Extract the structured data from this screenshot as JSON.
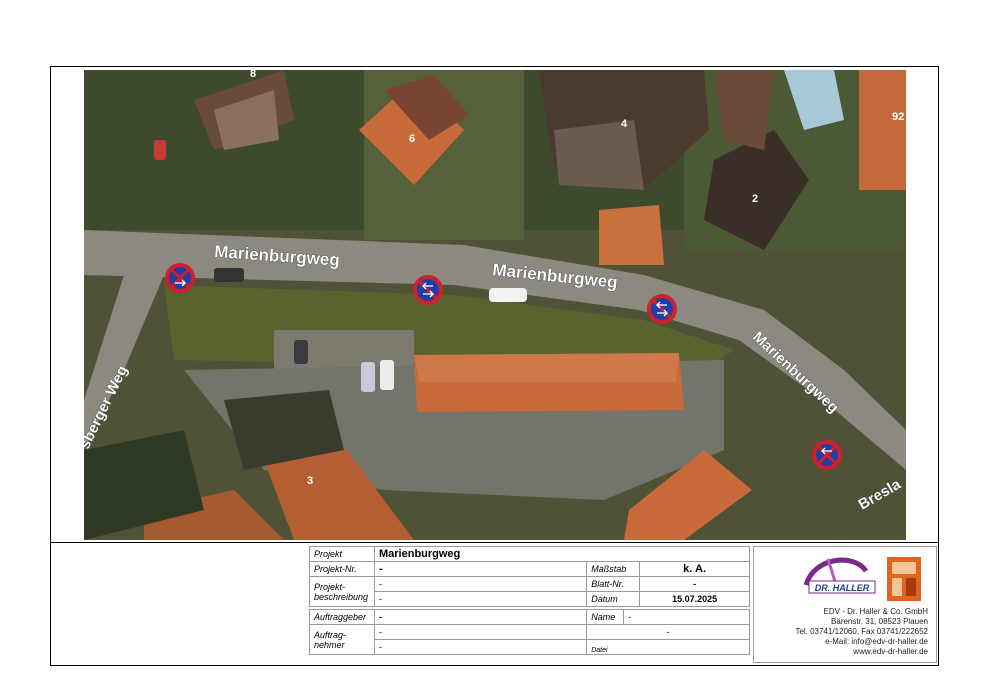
{
  "map": {
    "street_labels": [
      "Marienburgweg",
      "Marienburgweg",
      "Marienburgweg",
      "sberger Weg",
      "Bresla"
    ],
    "house_numbers": [
      "8",
      "6",
      "4",
      "92",
      "2",
      "3"
    ],
    "sign_icon": "no-stopping-sign-icon",
    "sign_count": 4
  },
  "title_block": {
    "projekt_label": "Projekt",
    "projekt_value": "Marienburgweg",
    "projekt_nr_label": "Projekt-Nr.",
    "projekt_nr_value": "-",
    "massstab_label": "Maßstab",
    "massstab_value": "k. A.",
    "beschreibung_label_1": "Projekt-",
    "beschreibung_label_2": "beschreibung",
    "beschreibung_value_1": "-",
    "beschreibung_value_2": "-",
    "blatt_label": "Blatt-Nr.",
    "blatt_value": "-",
    "datum_label": "Datum",
    "datum_value": "15.07.2025",
    "auftraggeber_label": "Auftraggeber",
    "auftraggeber_value": "-",
    "name_label": "Name",
    "name_value": "-",
    "auftragnehmer_label_1": "Auftrag-",
    "auftragnehmer_label_2": "nehmer",
    "auftragnehmer_value_1": "-",
    "auftragnehmer_value_2": "-",
    "name_value_2": "-",
    "datei_label": "Datei"
  },
  "company": {
    "logo_text": "DR. HALLER",
    "line1": "EDV - Dr. Haller & Co. GmbH",
    "line2": "Bärenstr. 31, 08523 Plauen",
    "line3": "Tel. 03741/12060, Fax 03741/222652",
    "line4": "e-Mail: info@edv-dr-haller.de",
    "line5": "www.edv-dr-haller.de",
    "accent": "#7a2a8a"
  }
}
